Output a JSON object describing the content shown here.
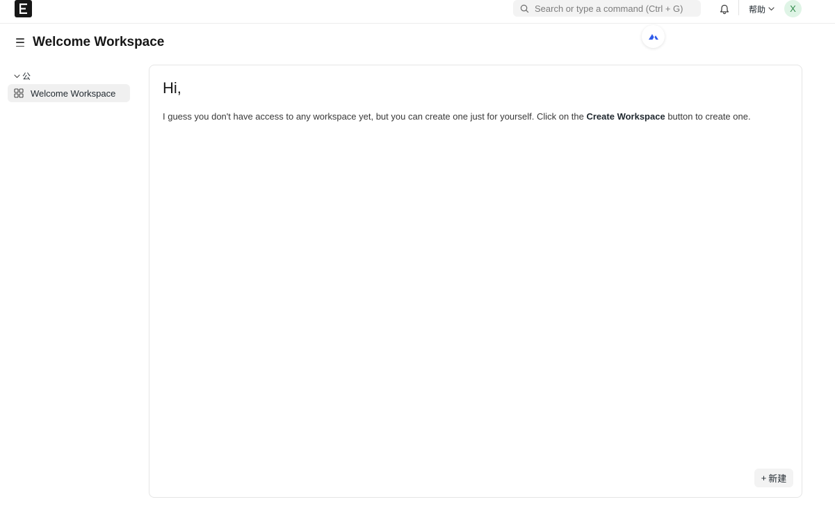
{
  "navbar": {
    "logo_letter": "E",
    "search_placeholder": "Search or type a command (Ctrl + G)",
    "help_label": "帮助",
    "avatar_initial": "X"
  },
  "header": {
    "title": "Welcome Workspace"
  },
  "sidebar": {
    "section_label": "公",
    "items": [
      {
        "label": "Welcome Workspace",
        "icon": "grid-icon"
      }
    ]
  },
  "main": {
    "greeting": "Hi,",
    "message_before": "I guess you don't have access to any workspace yet, but you can create one just for yourself. Click on the ",
    "message_bold": "Create Workspace",
    "message_after": " button to create one.",
    "new_button_label": "新建"
  },
  "colors": {
    "logo_bg": "#171717",
    "avatar_bg": "#dff4e6",
    "avatar_text": "#2f8a4a",
    "badge_icon": "#2f5bea"
  }
}
